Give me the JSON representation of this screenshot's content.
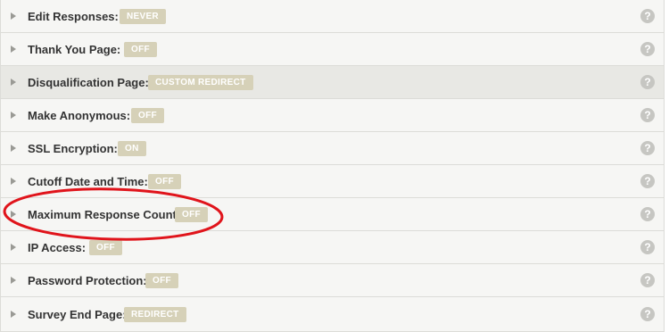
{
  "settings": {
    "rows": [
      {
        "label": "Edit Responses:",
        "value": "NEVER"
      },
      {
        "label": "Thank You Page:",
        "value": "OFF"
      },
      {
        "label": "Disqualification Page:",
        "value": "CUSTOM REDIRECT"
      },
      {
        "label": "Make Anonymous:",
        "value": "OFF"
      },
      {
        "label": "SSL Encryption:",
        "value": "ON"
      },
      {
        "label": "Cutoff Date and Time:",
        "value": "OFF"
      },
      {
        "label": "Maximum Response Count:",
        "value": "OFF"
      },
      {
        "label": "IP Access:",
        "value": "OFF"
      },
      {
        "label": "Password Protection:",
        "value": "OFF"
      },
      {
        "label": "Survey End Page:",
        "value": "REDIRECT"
      }
    ],
    "help_glyph": "?",
    "highlighted_row": "Disqualification Page:",
    "annotated_row": "Maximum Response Count:"
  },
  "colors": {
    "badge": "#d6d1b8",
    "annotation": "#e0141b",
    "help_icon": "#c6c6c2"
  }
}
